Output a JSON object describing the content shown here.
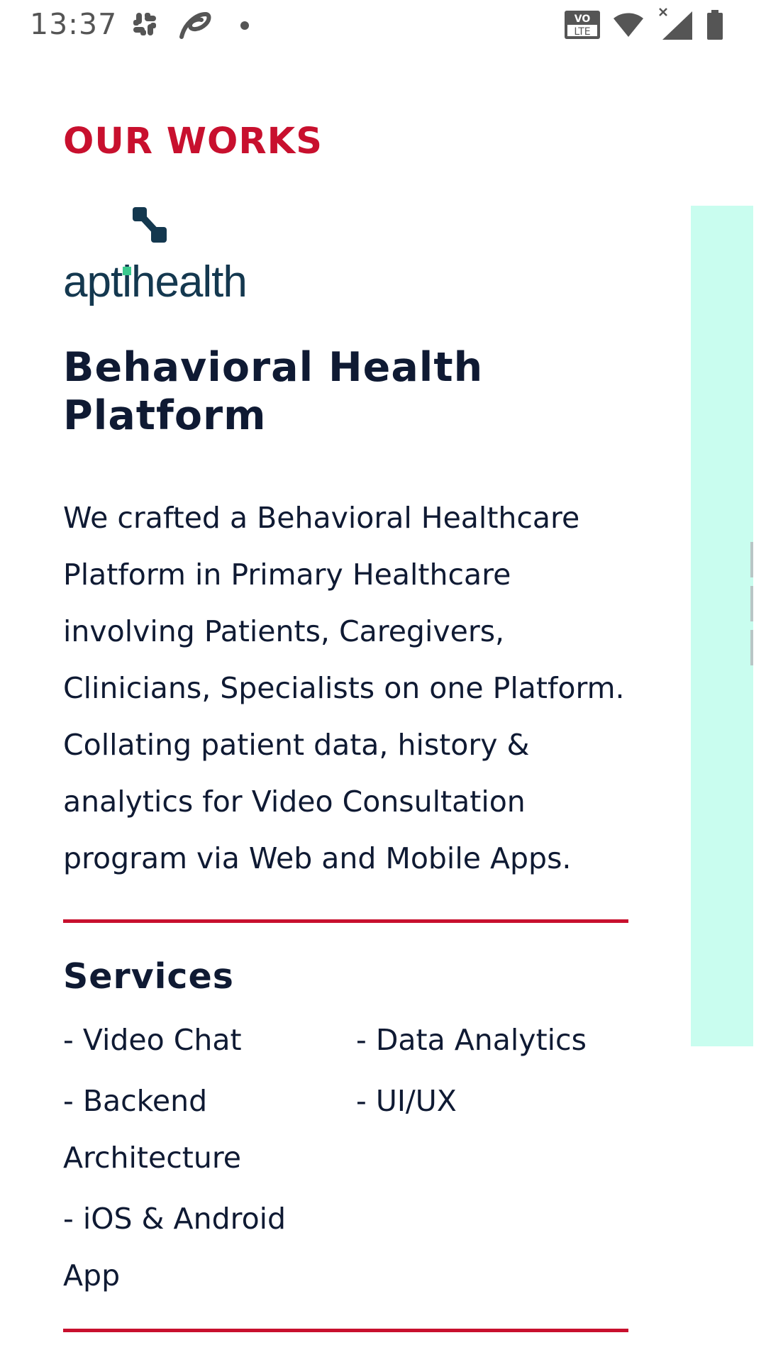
{
  "status_bar": {
    "time": "13:37",
    "icons": [
      "slack-icon",
      "swirl-icon",
      "notification-dot-icon",
      "volte-icon",
      "wifi-icon",
      "signal-icon",
      "battery-icon"
    ],
    "volte_top": "VO",
    "volte_bottom": "LTE"
  },
  "section": {
    "heading": "OUR WORKS",
    "heading_color": "#c8102e"
  },
  "project": {
    "logo_text": "aptihealth",
    "logo_color": "#14384f",
    "logo_accent_color": "#3cc98e",
    "title": "Behavioral Health Platform",
    "description": "We crafted a Behavioral Healthcare Platform in Primary Healthcare involving Patients, Caregivers, Clinicians, Specialists on one Platform. Collating patient data, history & analytics for Video Consultation program via Web and Mobile Apps.",
    "services_heading": "Services",
    "services_left": [
      "- Video Chat",
      "- Backend Architecture",
      "- iOS & Android App"
    ],
    "services_right": [
      "- Data Analytics",
      "- UI/UX"
    ]
  },
  "carousel": {
    "next_card_color": "#c9fdef"
  }
}
